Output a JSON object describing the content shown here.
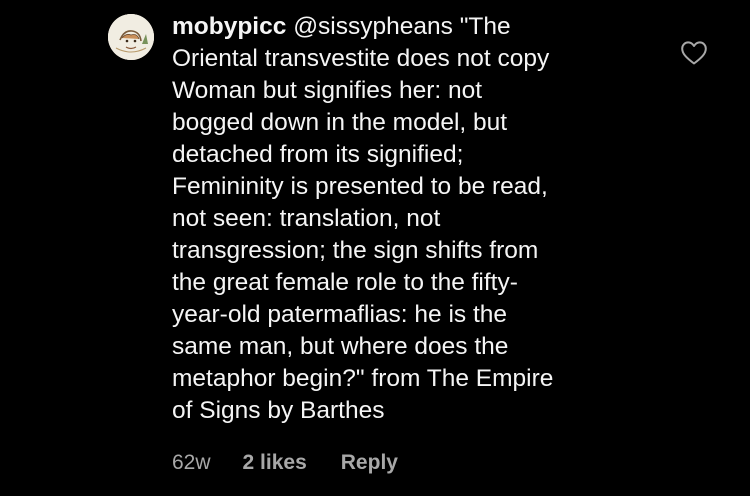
{
  "comment": {
    "username": "mobypicc",
    "mention": "@sissypheans",
    "text": "\"The\nOriental transvestite does not copy\nWoman but signifies her: not\nbogged down in the model, but\ndetached from its signified;\nFemininity is presented to be read,\nnot seen: translation, not\ntransgression; the sign shifts from\nthe great female role to the fifty-\nyear-old patermaflias: he is the\nsame man, but where  does the\nmetaphor begin?\" from The Empire\nof Signs by Barthes",
    "age": "62w",
    "likes": "2 likes",
    "reply_label": "Reply"
  },
  "icons": {
    "avatar": "avatar-drawing",
    "like": "heart-outline-icon"
  },
  "colors": {
    "background": "#000000",
    "text_primary": "#f5f5f5",
    "text_secondary": "#a8a8a8"
  }
}
